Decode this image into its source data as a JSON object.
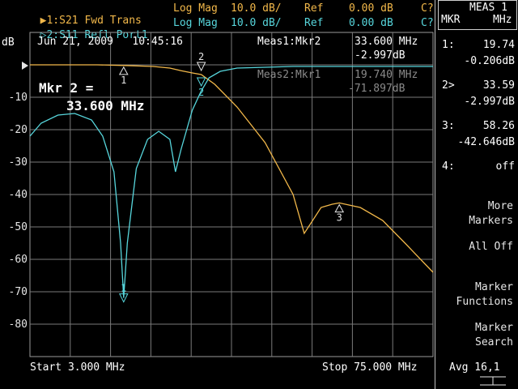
{
  "traces": [
    {
      "label": "1:S21 Fwd Trans",
      "format": "Log Mag",
      "scale": "10.0 dB/",
      "ref_label": "Ref",
      "ref": "0.00 dB",
      "flag": "C?",
      "color": "#f2b84a"
    },
    {
      "label": "2:S11 Refl Port1",
      "format": "Log Mag",
      "scale": "10.0 dB/",
      "ref_label": "Ref",
      "ref": "0.00 dB",
      "flag": "C?",
      "color": "#57d6dc"
    }
  ],
  "unit_label": "dB",
  "date_time": "Jun 21, 2009   10:45:16",
  "meas1": {
    "label": "Meas1:Mkr2",
    "freq": "33.600 MHz",
    "value": "-2.997dB"
  },
  "meas2": {
    "label": "Meas2:Mkr1",
    "freq": "19.740 MHz",
    "value": "-71.897dB"
  },
  "active_marker": {
    "line1": "Mkr 2 =",
    "line2": "33.600 MHz"
  },
  "y_ticks": [
    "",
    "-10",
    "-20",
    "-30",
    "-40",
    "-50",
    "-60",
    "-70",
    "-80"
  ],
  "start": "Start 3.000 MHz",
  "stop": "Stop 75.000 MHz",
  "avg": "Avg 16,1",
  "meas_box": {
    "title": "MEAS 1",
    "col1": "MKR",
    "col2": "MHz"
  },
  "marker_table": [
    {
      "num": "1:",
      "freq": "19.74",
      "value": "-0.206dB"
    },
    {
      "num": "2>",
      "freq": "33.59",
      "value": "-2.997dB"
    },
    {
      "num": "3:",
      "freq": "58.26",
      "value": "-42.646dB"
    },
    {
      "num": "4:",
      "freq": "off",
      "value": ""
    }
  ],
  "softkeys": [
    {
      "line1": "More",
      "line2": "Markers"
    },
    {
      "line1": "All Off",
      "line2": ""
    },
    {
      "line1": "Marker",
      "line2": "Functions"
    },
    {
      "line1": "Marker",
      "line2": "Search"
    }
  ],
  "chart_data": {
    "type": "line",
    "x_range_mhz": [
      3,
      75
    ],
    "ylim": [
      -90,
      10
    ],
    "series": [
      {
        "name": "1:S21 Fwd Trans",
        "color": "#f2b84a",
        "x": [
          3,
          10,
          15,
          20,
          25,
          28,
          30,
          32,
          33.6,
          36,
          40,
          45,
          50,
          52,
          55,
          57,
          58.26,
          62,
          66,
          70,
          75
        ],
        "y": [
          0,
          0,
          0,
          -0.2,
          -0.5,
          -1,
          -1.8,
          -2.5,
          -3.0,
          -6,
          -13,
          -24,
          -40,
          -52,
          -44,
          -43,
          -42.6,
          -44,
          -48,
          -55,
          -64
        ]
      },
      {
        "name": "2:S11 Refl Port1",
        "color": "#57d6dc",
        "x": [
          3,
          5,
          8,
          11,
          14,
          16,
          18,
          19.2,
          19.74,
          20.4,
          22,
          24,
          26,
          28,
          29,
          30,
          32,
          33.6,
          35,
          37,
          40,
          50,
          60,
          75
        ],
        "y": [
          -22,
          -18,
          -15.5,
          -15,
          -17,
          -22,
          -33,
          -55,
          -71.9,
          -55,
          -32,
          -23,
          -20.5,
          -23,
          -33,
          -26,
          -14,
          -8,
          -4,
          -2,
          -1,
          -0.5,
          -0.5,
          -0.5
        ]
      }
    ],
    "markers": [
      {
        "id": "1",
        "trace": 1,
        "x": 19.74,
        "y": -0.206
      },
      {
        "id": "2",
        "trace": 1,
        "x": 33.6,
        "y": -2.997
      },
      {
        "id": "3",
        "trace": 1,
        "x": 58.26,
        "y": -42.646
      },
      {
        "id": "1",
        "trace": 2,
        "x": 19.74,
        "y": -71.897
      },
      {
        "id": "2",
        "trace": 2,
        "x": 33.6,
        "y": -3
      }
    ]
  }
}
